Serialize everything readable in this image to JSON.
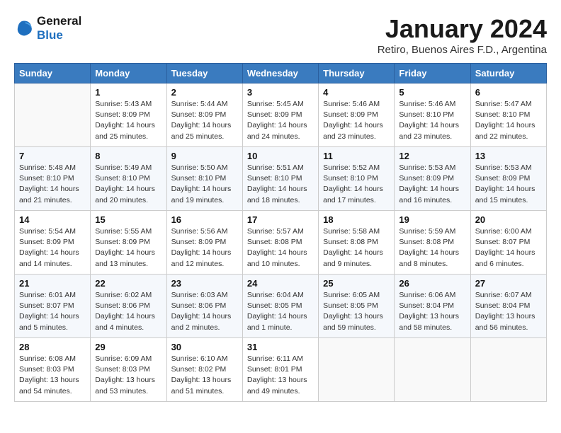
{
  "logo": {
    "line1": "General",
    "line2": "Blue"
  },
  "calendar": {
    "title": "January 2024",
    "subtitle": "Retiro, Buenos Aires F.D., Argentina",
    "days_of_week": [
      "Sunday",
      "Monday",
      "Tuesday",
      "Wednesday",
      "Thursday",
      "Friday",
      "Saturday"
    ],
    "weeks": [
      [
        {
          "num": "",
          "info": ""
        },
        {
          "num": "1",
          "info": "Sunrise: 5:43 AM\nSunset: 8:09 PM\nDaylight: 14 hours\nand 25 minutes."
        },
        {
          "num": "2",
          "info": "Sunrise: 5:44 AM\nSunset: 8:09 PM\nDaylight: 14 hours\nand 25 minutes."
        },
        {
          "num": "3",
          "info": "Sunrise: 5:45 AM\nSunset: 8:09 PM\nDaylight: 14 hours\nand 24 minutes."
        },
        {
          "num": "4",
          "info": "Sunrise: 5:46 AM\nSunset: 8:09 PM\nDaylight: 14 hours\nand 23 minutes."
        },
        {
          "num": "5",
          "info": "Sunrise: 5:46 AM\nSunset: 8:10 PM\nDaylight: 14 hours\nand 23 minutes."
        },
        {
          "num": "6",
          "info": "Sunrise: 5:47 AM\nSunset: 8:10 PM\nDaylight: 14 hours\nand 22 minutes."
        }
      ],
      [
        {
          "num": "7",
          "info": "Sunrise: 5:48 AM\nSunset: 8:10 PM\nDaylight: 14 hours\nand 21 minutes."
        },
        {
          "num": "8",
          "info": "Sunrise: 5:49 AM\nSunset: 8:10 PM\nDaylight: 14 hours\nand 20 minutes."
        },
        {
          "num": "9",
          "info": "Sunrise: 5:50 AM\nSunset: 8:10 PM\nDaylight: 14 hours\nand 19 minutes."
        },
        {
          "num": "10",
          "info": "Sunrise: 5:51 AM\nSunset: 8:10 PM\nDaylight: 14 hours\nand 18 minutes."
        },
        {
          "num": "11",
          "info": "Sunrise: 5:52 AM\nSunset: 8:10 PM\nDaylight: 14 hours\nand 17 minutes."
        },
        {
          "num": "12",
          "info": "Sunrise: 5:53 AM\nSunset: 8:09 PM\nDaylight: 14 hours\nand 16 minutes."
        },
        {
          "num": "13",
          "info": "Sunrise: 5:53 AM\nSunset: 8:09 PM\nDaylight: 14 hours\nand 15 minutes."
        }
      ],
      [
        {
          "num": "14",
          "info": "Sunrise: 5:54 AM\nSunset: 8:09 PM\nDaylight: 14 hours\nand 14 minutes."
        },
        {
          "num": "15",
          "info": "Sunrise: 5:55 AM\nSunset: 8:09 PM\nDaylight: 14 hours\nand 13 minutes."
        },
        {
          "num": "16",
          "info": "Sunrise: 5:56 AM\nSunset: 8:09 PM\nDaylight: 14 hours\nand 12 minutes."
        },
        {
          "num": "17",
          "info": "Sunrise: 5:57 AM\nSunset: 8:08 PM\nDaylight: 14 hours\nand 10 minutes."
        },
        {
          "num": "18",
          "info": "Sunrise: 5:58 AM\nSunset: 8:08 PM\nDaylight: 14 hours\nand 9 minutes."
        },
        {
          "num": "19",
          "info": "Sunrise: 5:59 AM\nSunset: 8:08 PM\nDaylight: 14 hours\nand 8 minutes."
        },
        {
          "num": "20",
          "info": "Sunrise: 6:00 AM\nSunset: 8:07 PM\nDaylight: 14 hours\nand 6 minutes."
        }
      ],
      [
        {
          "num": "21",
          "info": "Sunrise: 6:01 AM\nSunset: 8:07 PM\nDaylight: 14 hours\nand 5 minutes."
        },
        {
          "num": "22",
          "info": "Sunrise: 6:02 AM\nSunset: 8:06 PM\nDaylight: 14 hours\nand 4 minutes."
        },
        {
          "num": "23",
          "info": "Sunrise: 6:03 AM\nSunset: 8:06 PM\nDaylight: 14 hours\nand 2 minutes."
        },
        {
          "num": "24",
          "info": "Sunrise: 6:04 AM\nSunset: 8:05 PM\nDaylight: 14 hours\nand 1 minute."
        },
        {
          "num": "25",
          "info": "Sunrise: 6:05 AM\nSunset: 8:05 PM\nDaylight: 13 hours\nand 59 minutes."
        },
        {
          "num": "26",
          "info": "Sunrise: 6:06 AM\nSunset: 8:04 PM\nDaylight: 13 hours\nand 58 minutes."
        },
        {
          "num": "27",
          "info": "Sunrise: 6:07 AM\nSunset: 8:04 PM\nDaylight: 13 hours\nand 56 minutes."
        }
      ],
      [
        {
          "num": "28",
          "info": "Sunrise: 6:08 AM\nSunset: 8:03 PM\nDaylight: 13 hours\nand 54 minutes."
        },
        {
          "num": "29",
          "info": "Sunrise: 6:09 AM\nSunset: 8:03 PM\nDaylight: 13 hours\nand 53 minutes."
        },
        {
          "num": "30",
          "info": "Sunrise: 6:10 AM\nSunset: 8:02 PM\nDaylight: 13 hours\nand 51 minutes."
        },
        {
          "num": "31",
          "info": "Sunrise: 6:11 AM\nSunset: 8:01 PM\nDaylight: 13 hours\nand 49 minutes."
        },
        {
          "num": "",
          "info": ""
        },
        {
          "num": "",
          "info": ""
        },
        {
          "num": "",
          "info": ""
        }
      ]
    ]
  }
}
